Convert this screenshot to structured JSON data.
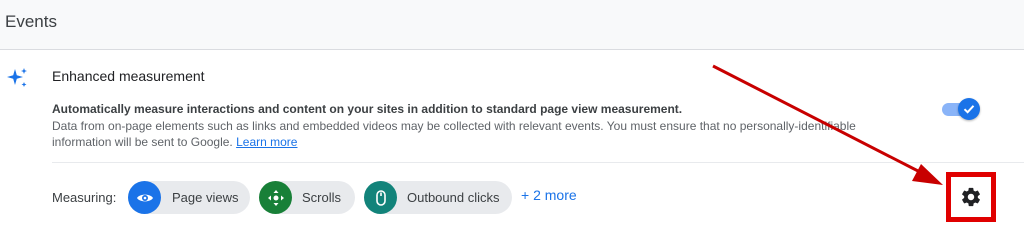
{
  "header": {
    "title": "Events"
  },
  "section": {
    "icon": "sparkle-icon",
    "title": "Enhanced measurement",
    "description_bold": "Automatically measure interactions and content on your sites in addition to standard page view measurement.",
    "description": "Data from on-page elements such as links and embedded videos may be collected with relevant events. You must ensure that no personally-identifiable information will be sent to Google.",
    "learn_more": "Learn more",
    "toggle_on": true
  },
  "measuring": {
    "label": "Measuring:",
    "chips": [
      {
        "label": "Page views",
        "icon": "eye-icon",
        "color": "#1a73e8"
      },
      {
        "label": "Scrolls",
        "icon": "scroll-arrows-icon",
        "color": "#188038"
      },
      {
        "label": "Outbound clicks",
        "icon": "mouse-icon",
        "color": "#12837a"
      }
    ],
    "more": "+ 2 more"
  },
  "settings": {
    "icon": "gear-icon"
  },
  "colors": {
    "accent": "#1a73e8",
    "highlight": "#e00000",
    "annotation_arrow": "#c80000"
  }
}
